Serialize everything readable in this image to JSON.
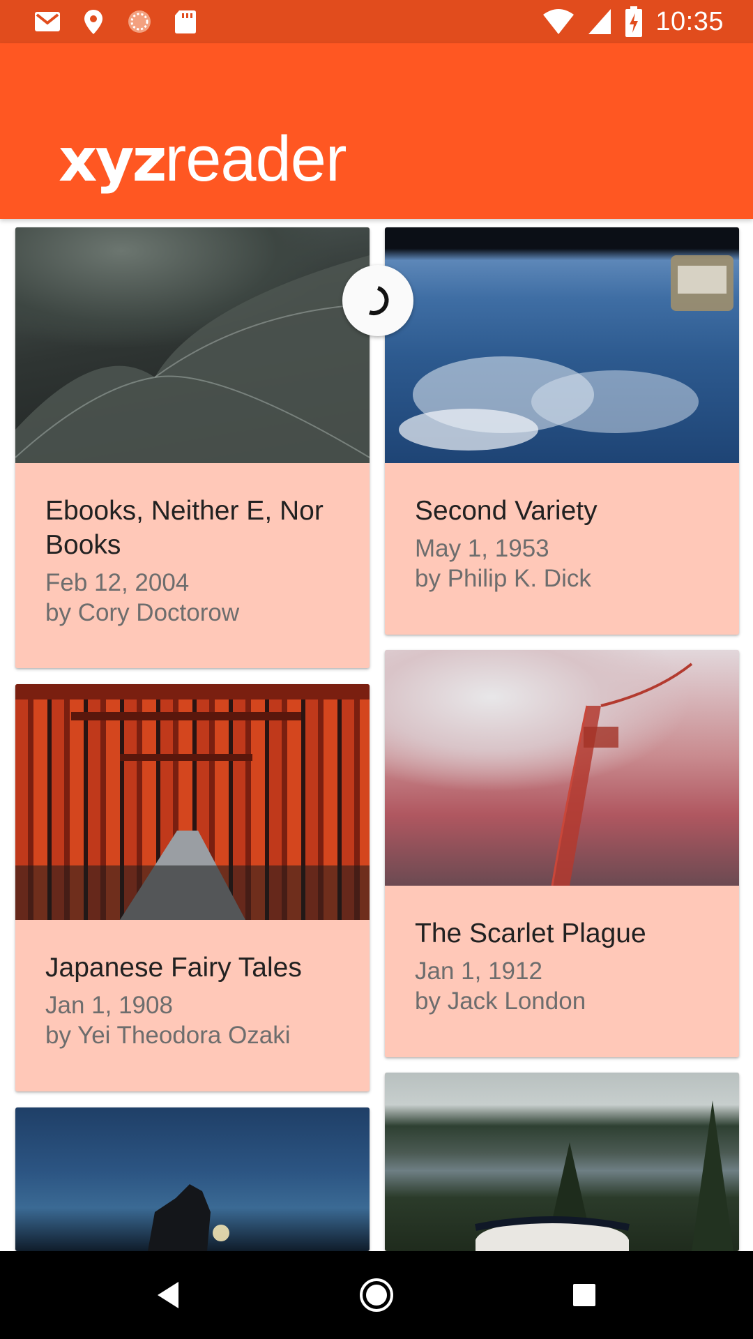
{
  "status_bar": {
    "time": "10:35",
    "left_icons": [
      "gmail-icon",
      "location-icon",
      "sync-icon",
      "sd-card-icon"
    ],
    "right_icons": [
      "wifi-icon",
      "signal-icon",
      "battery-charging-icon"
    ]
  },
  "app_bar": {
    "logo_bold": "xyz",
    "logo_light": "reader",
    "color": "#ff5722"
  },
  "colors": {
    "status_bar": "#e14c1d",
    "card_background": "#ffc8b8",
    "title_text": "#212121",
    "meta_text": "#6d6d6d"
  },
  "articles": [
    {
      "title": "Ebooks, Neither E, Nor Books",
      "date": "Feb 12, 2004",
      "author": "by Cory Doctorow",
      "thumbnail": "opera-house-roof-photo"
    },
    {
      "title": "Second Variety",
      "date": "May 1, 1953",
      "author": "by Philip K. Dick",
      "thumbnail": "earth-from-space-photo"
    },
    {
      "title": "Japanese Fairy Tales",
      "date": "Jan 1, 1908",
      "author": "by Yei Theodora Ozaki",
      "thumbnail": "torii-gates-photo"
    },
    {
      "title": "The Scarlet Plague",
      "date": "Jan 1, 1912",
      "author": "by Jack London",
      "thumbnail": "bridge-in-fog-photo"
    },
    {
      "title": "",
      "date": "",
      "author": "",
      "thumbnail": "lantern-at-dusk-photo"
    },
    {
      "title": "",
      "date": "",
      "author": "",
      "thumbnail": "lake-and-trees-photo"
    }
  ],
  "nav_bar": {
    "buttons": [
      "back-icon",
      "home-icon",
      "recents-icon"
    ]
  }
}
